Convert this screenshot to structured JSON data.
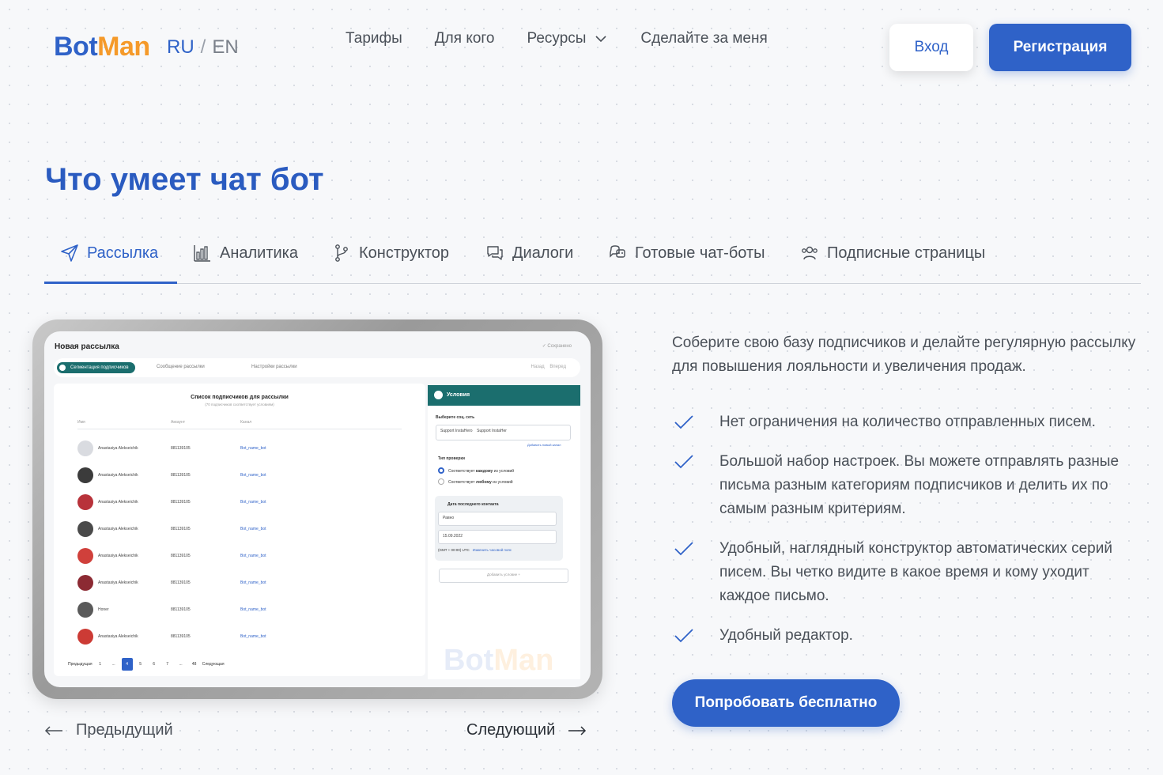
{
  "header": {
    "logo": {
      "part1": "Bot",
      "part2": "Man"
    },
    "lang": {
      "ru": "RU",
      "sep": "/",
      "en": "EN"
    },
    "nav": [
      "Тарифы",
      "Для кого",
      "Ресурсы",
      "Сделайте за меня"
    ],
    "login_label": "Вход",
    "register_label": "Регистрация"
  },
  "section": {
    "title": "Что умеет чат бот",
    "tabs": [
      {
        "label": "Рассылка",
        "icon": "send-icon",
        "active": true
      },
      {
        "label": "Аналитика",
        "icon": "bar-chart-icon"
      },
      {
        "label": "Конструктор",
        "icon": "branch-icon"
      },
      {
        "label": "Диалоги",
        "icon": "chat-icon"
      },
      {
        "label": "Готовые чат-боты",
        "icon": "bot-icon"
      },
      {
        "label": "Подписные страницы",
        "icon": "users-icon"
      }
    ]
  },
  "screen": {
    "title": "Новая рассылка",
    "saved": "✓ Сохранено",
    "steps": [
      "Сегментация подписчиков",
      "Сообщение рассылки",
      "Настройки рассылки"
    ],
    "step_nav": {
      "back": "Назад",
      "forward": "Вперед"
    },
    "list_title": "Список подписчиков для рассылки",
    "list_subtitle": "(70 подписчиков соответствует условиям)",
    "columns": [
      "Имя",
      "Аккаунт",
      "Канал"
    ],
    "rows": [
      {
        "name": "Anastasiya Alekseichik",
        "account": "881139105",
        "channel": "Bot_name_bot",
        "avatar_color": "#d9dbe0"
      },
      {
        "name": "Anastasiya Alekseichik",
        "account": "881139105",
        "channel": "Bot_name_bot",
        "avatar_color": "#3b3b3b"
      },
      {
        "name": "Anastasiya Alekseichik",
        "account": "881139105",
        "channel": "Bot_name_bot",
        "avatar_color": "#b8323a"
      },
      {
        "name": "Anastasiya Alekseichik",
        "account": "881139105",
        "channel": "Bot_name_bot",
        "avatar_color": "#4a4a4a"
      },
      {
        "name": "Anastasiya Alekseichik",
        "account": "881139105",
        "channel": "Bot_name_bot",
        "avatar_color": "#d0403b"
      },
      {
        "name": "Anastasiya Alekseichik",
        "account": "881139105",
        "channel": "Bot_name_bot",
        "avatar_color": "#8c2a33"
      },
      {
        "name": "Honer",
        "account": "881139105",
        "channel": "Bot_name_bot",
        "avatar_color": "#5a5a5a"
      },
      {
        "name": "Anastasiya Alekseichik",
        "account": "881139105",
        "channel": "Bot_name_bot",
        "avatar_color": "#cc3b35"
      }
    ],
    "pager": [
      "Предыдущая",
      "1",
      "...",
      "4",
      "5",
      "6",
      "7",
      "...",
      "48",
      "Следующая"
    ],
    "conditions": {
      "title": "Условия",
      "social_label": "Выберите соц. сеть",
      "channels": [
        "Support InstaHero",
        "Support InstaHer"
      ],
      "add_channel": "Добавить новый канал",
      "check_type": "Тип проверки",
      "option_all_prefix": "Соответствует",
      "option_all_bold": "каждому",
      "option_all_suffix": "из условий",
      "option_any_prefix": "Соответствует",
      "option_any_bold": "любому",
      "option_any_suffix": "из условий",
      "filter_title": "Дата последнего контакта",
      "operator": "Равно",
      "date": "15.09.2022",
      "timezone": "(GMT + 00:00) UTC",
      "change_tz": "Изменить часовой пояс",
      "add_condition": "Добавить условие  +"
    },
    "watermark": {
      "part1": "Bot",
      "part2": "Man"
    }
  },
  "pagination": {
    "prev": "Предыдущий",
    "next": "Следующий"
  },
  "content": {
    "intro": "Соберите свою базу подписчиков и делайте регулярную рассылку для повышения лояльности и увеличения продаж.",
    "features": [
      "Нет ограничения на количество отправленных писем.",
      "Большой набор настроек. Вы можете отправлять разные письма разным категориям подписчиков и делить их по самым разным критериям.",
      "Удобный, наглядный конструктор автоматических серий писем. Вы четко видите в какое время и кому уходит каждое письмо.",
      "Удобный редактор."
    ],
    "cta": "Попробовать бесплатно"
  },
  "colors": {
    "accent": "#2f62c8",
    "logo_orange": "#f59a2a",
    "teal": "#1b6e6e"
  }
}
